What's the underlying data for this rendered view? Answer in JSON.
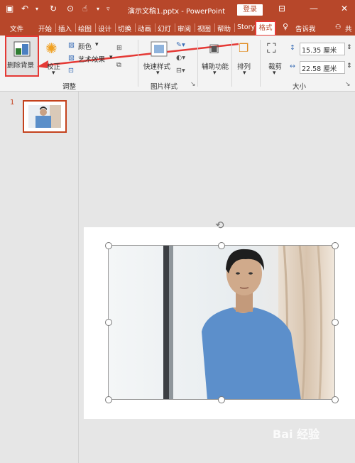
{
  "titlebar": {
    "title": "演示文稿1.pptx  -  PowerPoint",
    "login": "登录"
  },
  "tabs": [
    "文件",
    "开始",
    "插入",
    "绘图",
    "设计",
    "切换",
    "动画",
    "幻灯",
    "审阅",
    "视图",
    "帮助",
    "Story"
  ],
  "active_tab": "格式",
  "tell_me": "告诉我",
  "share": "共",
  "ribbon": {
    "remove_bg": "删除背景",
    "corrections": "校正",
    "color": "颜色",
    "artistic": "艺术效果",
    "group_adjust": "调整",
    "quick_styles": "快速样式",
    "group_picture_styles": "图片样式",
    "accessibility": "辅助功能",
    "arrange": "排列",
    "crop": "裁剪",
    "height_value": "15.35 厘米",
    "width_value": "22.58 厘米",
    "group_size": "大小"
  },
  "slide_number": "1",
  "watermark": "Bai 经验",
  "colors": {
    "accent": "#b7472a",
    "highlight": "#e53935"
  }
}
